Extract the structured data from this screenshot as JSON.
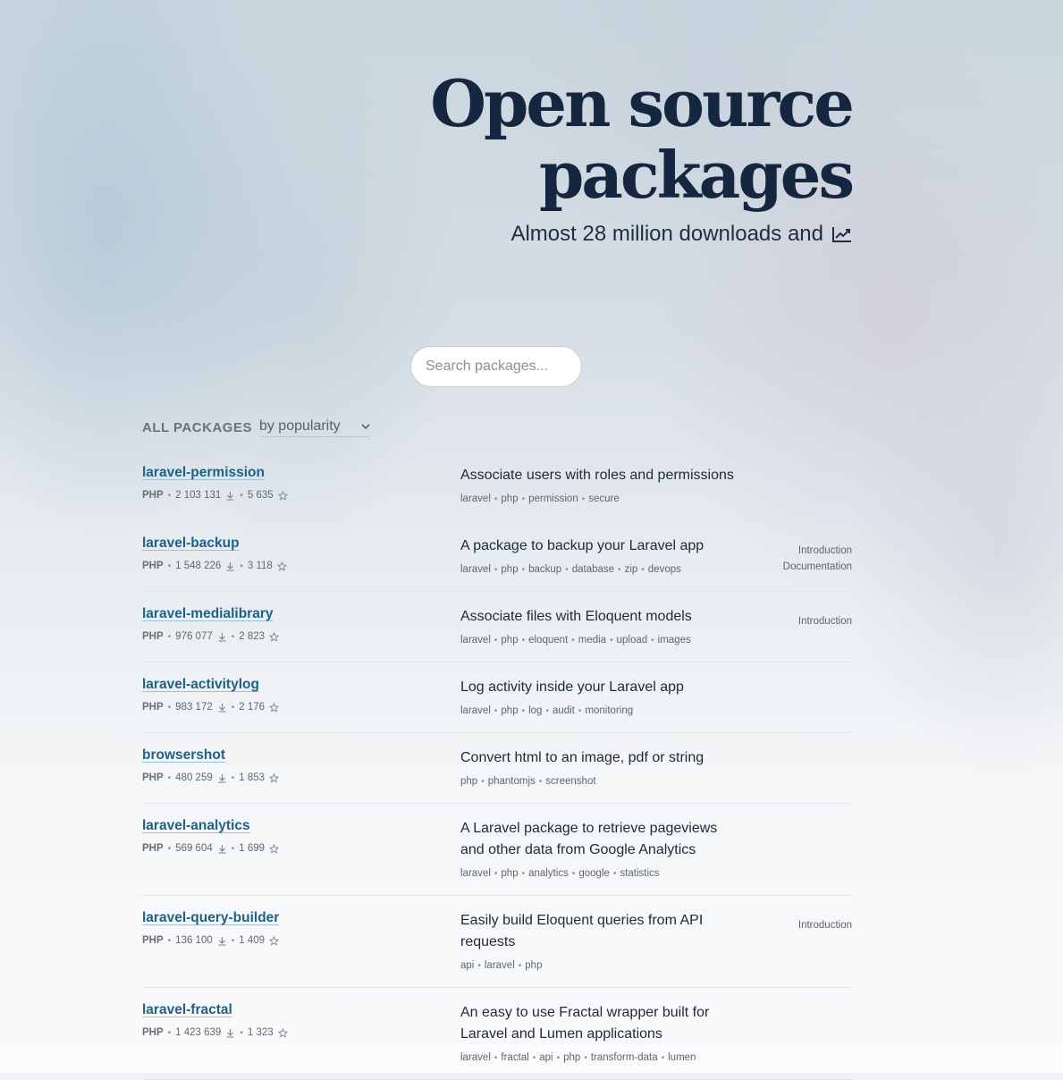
{
  "hero": {
    "title_line1": "Open source",
    "title_line2": "packages",
    "subtitle": "Almost 28 million downloads and",
    "subtitle_icon": "trending-up-icon"
  },
  "search": {
    "placeholder": "Search packages..."
  },
  "filter": {
    "label": "ALL PACKAGES",
    "sort_selected": "by popularity"
  },
  "colors": {
    "title": "#142640",
    "package_link": "#1e6288",
    "row_divider": "#e1e4e8"
  },
  "packages": [
    {
      "name": "laravel-permission",
      "lang": "PHP",
      "downloads": "2 103 131",
      "stars": "5 635",
      "description": "Associate users with roles and permissions",
      "tags": [
        "laravel",
        "php",
        "permission",
        "secure"
      ],
      "links": []
    },
    {
      "name": "laravel-backup",
      "lang": "PHP",
      "downloads": "1 548 226",
      "stars": "3 118",
      "description": "A package to backup your Laravel app",
      "tags": [
        "laravel",
        "php",
        "backup",
        "database",
        "zip",
        "devops"
      ],
      "links": [
        "Introduction",
        "Documentation"
      ]
    },
    {
      "name": "laravel-medialibrary",
      "lang": "PHP",
      "downloads": "976 077",
      "stars": "2 823",
      "description": "Associate files with Eloquent models",
      "tags": [
        "laravel",
        "php",
        "eloquent",
        "media",
        "upload",
        "images"
      ],
      "links": [
        "Introduction"
      ]
    },
    {
      "name": "laravel-activitylog",
      "lang": "PHP",
      "downloads": "983 172",
      "stars": "2 176",
      "description": "Log activity inside your Laravel app",
      "tags": [
        "laravel",
        "php",
        "log",
        "audit",
        "monitoring"
      ],
      "links": []
    },
    {
      "name": "browsershot",
      "lang": "PHP",
      "downloads": "480 259",
      "stars": "1 853",
      "description": "Convert html to an image, pdf or string",
      "tags": [
        "php",
        "phantomjs",
        "screenshot"
      ],
      "links": []
    },
    {
      "name": "laravel-analytics",
      "lang": "PHP",
      "downloads": "569 604",
      "stars": "1 699",
      "description": "A Laravel package to retrieve pageviews and other data from Google Analytics",
      "tags": [
        "laravel",
        "php",
        "analytics",
        "google",
        "statistics"
      ],
      "links": []
    },
    {
      "name": "laravel-query-builder",
      "lang": "PHP",
      "downloads": "136 100",
      "stars": "1 409",
      "description": "Easily build Eloquent queries from API requests",
      "tags": [
        "api",
        "laravel",
        "php"
      ],
      "links": [
        "Introduction"
      ]
    },
    {
      "name": "laravel-fractal",
      "lang": "PHP",
      "downloads": "1 423 639",
      "stars": "1 323",
      "description": "An easy to use Fractal wrapper built for Laravel and Lumen applications",
      "tags": [
        "laravel",
        "fractal",
        "api",
        "php",
        "transform-data",
        "lumen"
      ],
      "links": []
    }
  ]
}
